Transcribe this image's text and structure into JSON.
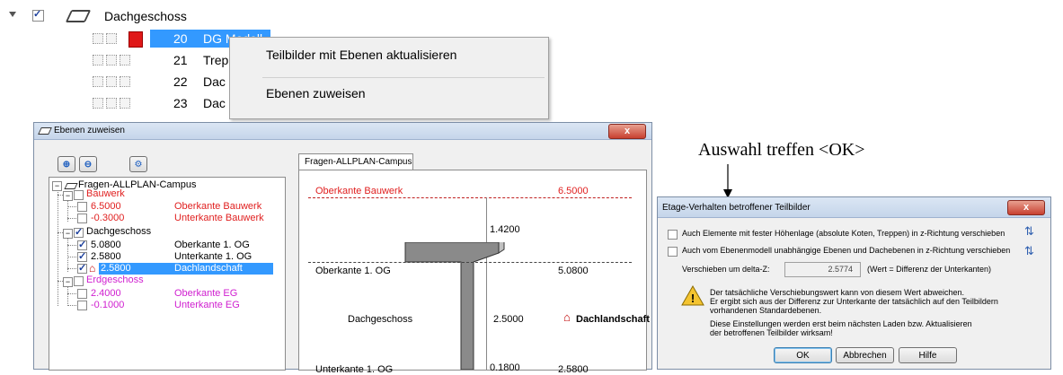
{
  "tree_top": {
    "group_label": "Dachgeschoss",
    "rows": [
      {
        "num": "20",
        "name": "DG Modell"
      },
      {
        "num": "21",
        "name": "Trep"
      },
      {
        "num": "22",
        "name": "Dac"
      },
      {
        "num": "23",
        "name": "Dac"
      }
    ]
  },
  "context_menu": {
    "item1": "Teilbilder mit Ebenen aktualisieren",
    "item2": "Ebenen zuweisen"
  },
  "annotation": {
    "text": "Auswahl treffen <OK>"
  },
  "dlg_ebenen": {
    "title": "Ebenen zuweisen",
    "close": "x",
    "tab_label": "Fragen-ALLPLAN-Campus",
    "tree_root": "Fragen-ALLPLAN-Campus",
    "tree": [
      {
        "group": "Bauwerk",
        "color": "#e02020",
        "items": [
          {
            "value": "6.5000",
            "name": "Oberkante Bauwerk",
            "checked": false
          },
          {
            "value": "-0.3000",
            "name": "Unterkante Bauwerk",
            "checked": false
          }
        ]
      },
      {
        "group": "Dachgeschoss",
        "color": "#000000",
        "items": [
          {
            "value": "5.0800",
            "name": "Oberkante 1. OG",
            "checked": true
          },
          {
            "value": "2.5800",
            "name": "Unterkante 1. OG",
            "checked": true
          },
          {
            "value": "2.5800",
            "name": "Dachlandschaft",
            "checked": true
          }
        ]
      },
      {
        "group": "Erdgeschoss",
        "color": "#d020d0",
        "items": [
          {
            "value": "2.4000",
            "name": "Oberkante EG",
            "checked": false
          },
          {
            "value": "-0.1000",
            "name": "Unterkante EG",
            "checked": false
          }
        ]
      }
    ],
    "diagram": {
      "top_label": "Oberkante Bauwerk",
      "top_value": "6.5000",
      "dim1": "1.4200",
      "ok_label": "Oberkante 1. OG",
      "ok_value": "5.0800",
      "mid_label": "Dachgeschoss",
      "mid_value": "2.5000",
      "roof_label": "Dachlandschaft",
      "uk_label": "Unterkante 1. OG",
      "uk_dim": "0.1800",
      "uk_value": "2.5800"
    }
  },
  "dlg_etage": {
    "title": "Etage-Verhalten betroffener Teilbilder",
    "close": "x",
    "opt1": "Auch Elemente mit fester Höhenlage (absolute Koten, Treppen) in z-Richtung verschieben",
    "opt2": "Auch vom Ebenenmodell unabhängige Ebenen und Dachebenen in z-Richtung verschieben",
    "shift_label": "Verschieben um delta-Z:",
    "shift_value": "2.5774",
    "shift_note": "(Wert = Differenz der Unterkanten)",
    "warn1": "Der tatsächliche Verschiebungswert kann von diesem Wert abweichen.",
    "warn2": "Er ergibt sich aus der Differenz zur Unterkante der tatsächlich auf den Teilbildern",
    "warn3": "vorhandenen Standardebenen.",
    "warn4": "Diese Einstellungen werden erst beim nächsten Laden bzw. Aktualisieren",
    "warn5": "der betroffenen Teilbilder wirksam!",
    "ok": "OK",
    "cancel": "Abbrechen",
    "help": "Hilfe"
  }
}
